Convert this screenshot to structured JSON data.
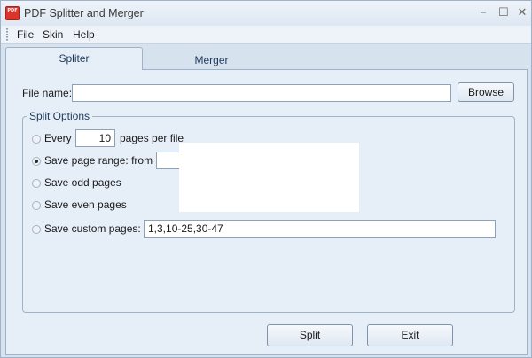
{
  "window": {
    "title": "PDF Splitter and Merger",
    "app_icon_text": "PDF"
  },
  "menu": {
    "file": "File",
    "skin": "Skin",
    "help": "Help"
  },
  "tabs": {
    "splitter": "Spliter",
    "merger": "Merger"
  },
  "file_name": {
    "label": "File name:",
    "value": "",
    "browse_label": "Browse"
  },
  "split_options": {
    "title": "Split Options",
    "every_label": "Every",
    "every_value": "10",
    "pages_per_file_label": "pages per file",
    "range_label": "Save page range: from",
    "range_from_value": "",
    "odd_label": "Save odd pages",
    "even_label": "Save even pages",
    "custom_label": "Save custom pages:",
    "custom_value": "1,3,10-25,30-47",
    "selected": "page-range"
  },
  "actions": {
    "split_label": "Split",
    "exit_label": "Exit"
  }
}
